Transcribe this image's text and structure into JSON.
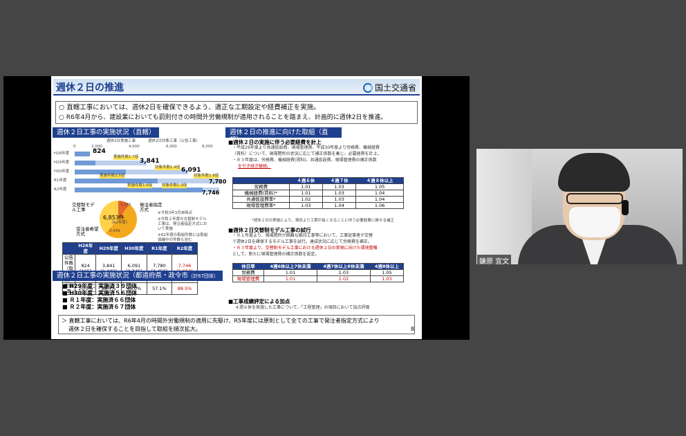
{
  "slide": {
    "title": "週休２日の推進",
    "ministry": "国土交通省",
    "intro": [
      "○ 直轄工事においては、週休2日を確保できるよう、適正な工期設定や経費補正を実施。",
      "○ R6年4月から、建設業においても罰則付きの時間外労働規制が適用されることを踏まえ、計画的に週休2日を推進。"
    ],
    "left_header": "週休２日工事の実施状況（直轄）",
    "right_header": "週休２日の推進に向けた取組（直轄）",
    "chart_legend": [
      "週休2日実施工事",
      "週休2日対象工事（公告工事）"
    ],
    "chart_ticks": [
      "0",
      "2,000",
      "4,000",
      "6,000",
      "8,000"
    ],
    "chart_rows": [
      "H28年度",
      "H29年度",
      "H30年度",
      "R1年度",
      "R2年度"
    ],
    "chart_callouts": [
      "824",
      "3,841",
      "6,091",
      "7,780",
      "7,746"
    ],
    "chart_notes": [
      "実施件数1.7倍",
      "対象件数1.4倍",
      "実施件数2.5倍",
      "対象件数1.8倍",
      "実施件数1.6倍",
      "対象件数1.3倍"
    ],
    "pie_labels": [
      "交替制モデル工事",
      "発注者指定方式",
      "受注者希望方式"
    ],
    "pie_total": "6,853件",
    "pie_total_sub": "（R2年度）",
    "pie_values": [
      "1,161",
      "3,449"
    ],
    "pie_notes": [
      "※令和3年3月末時点",
      "※令和２年度の交替制モデル工事は、発注者指定方式において実施",
      "※R2年度の取組件数には取組協議中の件数も含む"
    ],
    "stats_header": [
      "",
      "H28年度",
      "H29年度",
      "H30年度",
      "R1年度",
      "R2年度"
    ],
    "stats_rows": [
      [
        "公告件数（取組件数）",
        "824（165）",
        "3,841（1,106）",
        "6,091（2,745）",
        "7,780（4,450）",
        "7,746（6,853）"
      ],
      [
        "実施率",
        "20.0%",
        "28.7%",
        "45.0%",
        "57.1%",
        "88.5%"
      ]
    ],
    "pref_header": "週休２日工事の実施状況（都道府県・政令市",
    "pref_header_sm": "（計67団体）",
    "pref_items": [
      "■ H29年度：実施済３９団体",
      "■ H30年度：実施済５６団体",
      "■ Ｒ１年度：実施済６６団体",
      "■ Ｒ２年度：実施済６７団体"
    ],
    "r1_title": "■週休２日の実施に伴う必要経費を計上",
    "r1_lines": [
      "・平成29年度より共通仮設費、現場管理費、平成30年度より労務費、機械経費",
      "（賃料）について、現場閉所の状況に応じて補正係数を乗じ、必要経費を計上。",
      "・Ｒ３年度は、労務費、機械経費(賃料)、共通仮設費、現場管理費の補正係数",
      "を引き続き継続。"
    ],
    "cost_header": [
      "",
      "４週６休",
      "４週７休",
      "４週８休以上"
    ],
    "cost_rows": [
      [
        "労務費",
        "1.01",
        "1.03",
        "1.05"
      ],
      [
        "機械経費(賃料)*",
        "1.01",
        "1.03",
        "1.04"
      ],
      [
        "共通仮設費率*",
        "1.02",
        "1.03",
        "1.04"
      ],
      [
        "現場管理費率*",
        "1.03",
        "1.04",
        "1.06"
      ]
    ],
    "cost_note": "*週休２日の実施により、現状より工期が長くなることに伴う必要経費に関する補正",
    "r2_title": "■週休２日交替制モデル工事の試行",
    "r2_lines": [
      "・Ｒ１年度より、現場閉所が困難な維持工事等において、工事従事者が交替",
      "で週休2日を確保するモデル工事を試行。達成状況に応じて労務費を補正。",
      "・Ｒ３年度より、交替制モデル工事における週休２日の実現に向けた環境整備",
      "として、新たに現場管理費の補正係数を設定。"
    ],
    "rate_header": [
      "休日率",
      "4週6休以上7休未満",
      "4週7休以上8休未満",
      "4週8休以上"
    ],
    "rate_rows": [
      [
        "労務費",
        "1.01",
        "1.03",
        "1.05"
      ],
      [
        "現場管理費",
        "1.01",
        "1.02",
        "1.03"
      ]
    ],
    "r3_title": "■工事成績評定による加点",
    "r3_line": "４週８休を実施した工事について、「工程管理」の項目において加点評価",
    "bottom": [
      "＞ 直轄工事においては、R6年4月の時間外労働規制の適用に先駆け、R5年度には原則として全ての工事で発注者指定方式により",
      "週休２日を確保することを目指して取組を順次拡大。"
    ],
    "page_number": "8"
  },
  "camera": {
    "name": "鎌原 宜文"
  },
  "colors": {
    "navy": "#1f3f8f",
    "accent_red": "#c00000",
    "pie_orange": "#f4a81d",
    "bar_blue": "#6f9ad6"
  }
}
